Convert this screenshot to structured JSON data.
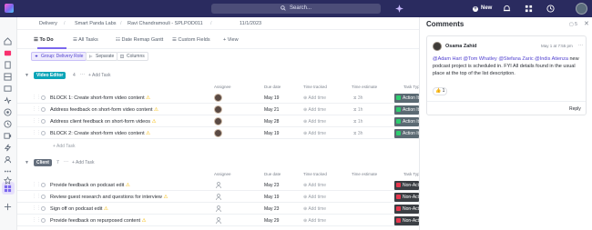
{
  "topbar": {
    "search_label": "Search...",
    "new_label": "New",
    "icons": [
      "clickup-logo",
      "search-icon",
      "ai-icon",
      "plus-icon",
      "bell-icon",
      "grid-icon",
      "clock-icon",
      "avatar"
    ]
  },
  "rail": {
    "icons": [
      "home-icon",
      "inbox-icon",
      "docs-icon",
      "dashboards-icon",
      "whiteboards-icon",
      "pulse-icon",
      "goals-icon",
      "timesheets-icon",
      "clips-icon",
      "automations-icon",
      "team-icon",
      "more-icon",
      "favorites-icon",
      "spaces-icon",
      "add-icon"
    ]
  },
  "breadcrumb": {
    "items": [
      "Delivery",
      "Smart Panda Labs",
      "Ravi Chandramouli - SPLPOD011",
      "11/1/2023"
    ]
  },
  "tabs": [
    {
      "label": "To Do",
      "icon": "list-icon",
      "active": true
    },
    {
      "label": "All Tasks",
      "icon": "list-icon",
      "active": false
    },
    {
      "label": "Date Remap Gantt",
      "icon": "gantt-icon",
      "active": false
    },
    {
      "label": "Custom Fields",
      "icon": "list-icon",
      "active": false
    },
    {
      "label": "+ View",
      "icon": "",
      "active": false
    }
  ],
  "filters": [
    {
      "label": "Group: Delivery Role",
      "active": true
    },
    {
      "label": "Separate",
      "active": false
    },
    {
      "label": "Columns",
      "active": false
    }
  ],
  "columns": {
    "assignee": "Assignee",
    "due_date": "Due date",
    "time_tracked": "Time tracked",
    "time_estimate": "Time estimate",
    "task_type": "Task Type"
  },
  "groups": [
    {
      "name": "Video Editor",
      "color": "#0ba5b8",
      "count": "4",
      "add_task_label": "+ Add Task",
      "tasks": [
        {
          "name": "BLOCK 1: Create short-form video content",
          "due": "May 19",
          "tracked": "Add time",
          "estimate": "3h",
          "type": "Action Item",
          "type_color": "#5b6a73",
          "assigned": true
        },
        {
          "name": "Address feedback on short-form video content",
          "due": "May 21",
          "tracked": "Add time",
          "estimate": "1h",
          "type": "Action Item",
          "type_color": "#5b6a73",
          "assigned": true
        },
        {
          "name": "Address client feedback on short-form videos",
          "due": "May 28",
          "tracked": "Add time",
          "estimate": "1h",
          "type": "Action Item",
          "type_color": "#5b6a73",
          "assigned": true
        },
        {
          "name": "BLOCK 2: Create short-form video content",
          "due": "May 19",
          "tracked": "Add time",
          "estimate": "3h",
          "type": "Action Item",
          "type_color": "#5b6a73",
          "assigned": true
        }
      ],
      "footer_add": "+ Add Task"
    },
    {
      "name": "Client",
      "color": "#656f7d",
      "count": "7",
      "add_task_label": "+ Add Task",
      "tasks": [
        {
          "name": "Provide feedback on podcast edit",
          "due": "May 23",
          "tracked": "Add time",
          "estimate": "",
          "type": "Non-Action",
          "type_color": "#3b3f44",
          "assigned": false
        },
        {
          "name": "Review guest research and questions for interview",
          "due": "May 19",
          "tracked": "Add time",
          "estimate": "",
          "type": "Non-Action",
          "type_color": "#3b3f44",
          "assigned": false
        },
        {
          "name": "Sign off on podcast edit",
          "due": "May 23",
          "tracked": "Add time",
          "estimate": "",
          "type": "Non-Action",
          "type_color": "#3b3f44",
          "assigned": false
        },
        {
          "name": "Provide feedback on repurposed content",
          "due": "May 29",
          "tracked": "Add time",
          "estimate": "",
          "type": "Non-Action",
          "type_color": "#3b3f44",
          "assigned": false
        }
      ]
    }
  ],
  "comments": {
    "title": "Comments",
    "count": "5",
    "card": {
      "author": "Osama Zahid",
      "time": "May 1 at 7:55 pm",
      "mentions": [
        "@Adam Hart",
        "@Tom Whatley",
        "@Stefana Zaric",
        "@Indis Atienza"
      ],
      "body_rest": " new podcast project is scheduled in. FYI All details found in the usual place at the top of the list description.",
      "reaction": "👍 1",
      "reply_label": "Reply"
    }
  },
  "colors": {
    "accent": "#7b68ee",
    "topbar": "#2a2b5f",
    "status_todo": "#d3d5da",
    "flag_yellow": "#f5b800"
  }
}
